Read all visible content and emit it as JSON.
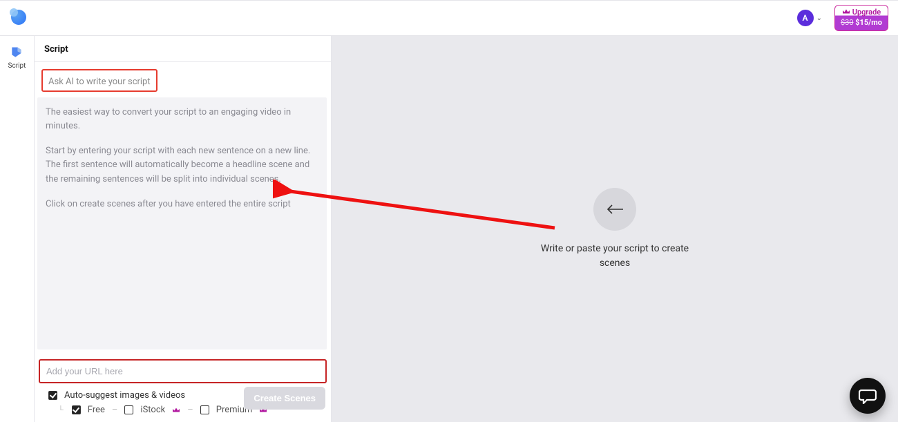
{
  "header": {
    "avatar_letter": "A",
    "upgrade_label": "Upgrade",
    "upgrade_old_price": "$30",
    "upgrade_new_price": "$15/mo"
  },
  "sidenav": {
    "script_label": "Script"
  },
  "panel": {
    "title": "Script",
    "ask_ai": "Ask AI to write your script",
    "placeholder_p1": "The easiest way to convert your script to an engaging video in minutes.",
    "placeholder_p2": "Start by entering your script with each new sentence on a new line. The first sentence will automatically become a headline scene and the remaining sentences will be split into individual scenes.",
    "placeholder_p3": "Click on create scenes after you have entered the entire script",
    "url_placeholder": "Add your URL here",
    "auto_suggest_label": "Auto-suggest images & videos",
    "opt_free": "Free",
    "opt_istock": "iStock",
    "opt_premium": "Premium",
    "create_btn": "Create Scenes"
  },
  "canvas": {
    "hint": "Write or paste your script to create scenes"
  }
}
